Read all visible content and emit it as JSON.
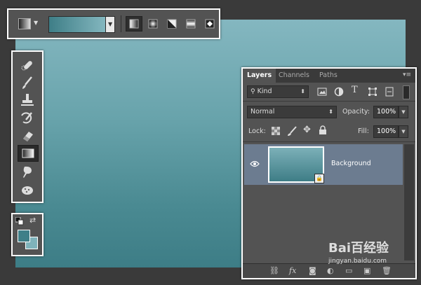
{
  "options_bar": {
    "gradient_types": [
      "linear-gradient-icon",
      "radial-gradient-icon",
      "angle-gradient-icon",
      "reflected-gradient-icon",
      "diamond-gradient-icon"
    ],
    "selected_type": 0,
    "gradient_colors": [
      "#3e7e87",
      "#85b8c0"
    ]
  },
  "tools": {
    "items": [
      "spot-healing-brush-icon",
      "brush-icon",
      "clone-stamp-icon",
      "history-brush-icon",
      "eraser-icon",
      "gradient-icon",
      "smudge-icon",
      "sponge-icon"
    ],
    "selected": 5
  },
  "colors": {
    "foreground": "#3f7f88",
    "background": "#7fb3bb"
  },
  "canvas": {
    "gradient_top": "#84b7c0",
    "gradient_bottom": "#3d7d86"
  },
  "layers_panel": {
    "tabs": [
      "Layers",
      "Channels",
      "Paths"
    ],
    "active_tab": "Layers",
    "filter_value": "Kind",
    "blend_mode": "Normal",
    "opacity_label": "Opacity:",
    "opacity_value": "100%",
    "lock_label": "Lock:",
    "fill_label": "Fill:",
    "fill_value": "100%",
    "layers": [
      {
        "name": "Background",
        "visible": true,
        "locked": true
      }
    ]
  },
  "watermark": {
    "text": "Bai百经验",
    "sub": "jingyan.baidu.com"
  }
}
